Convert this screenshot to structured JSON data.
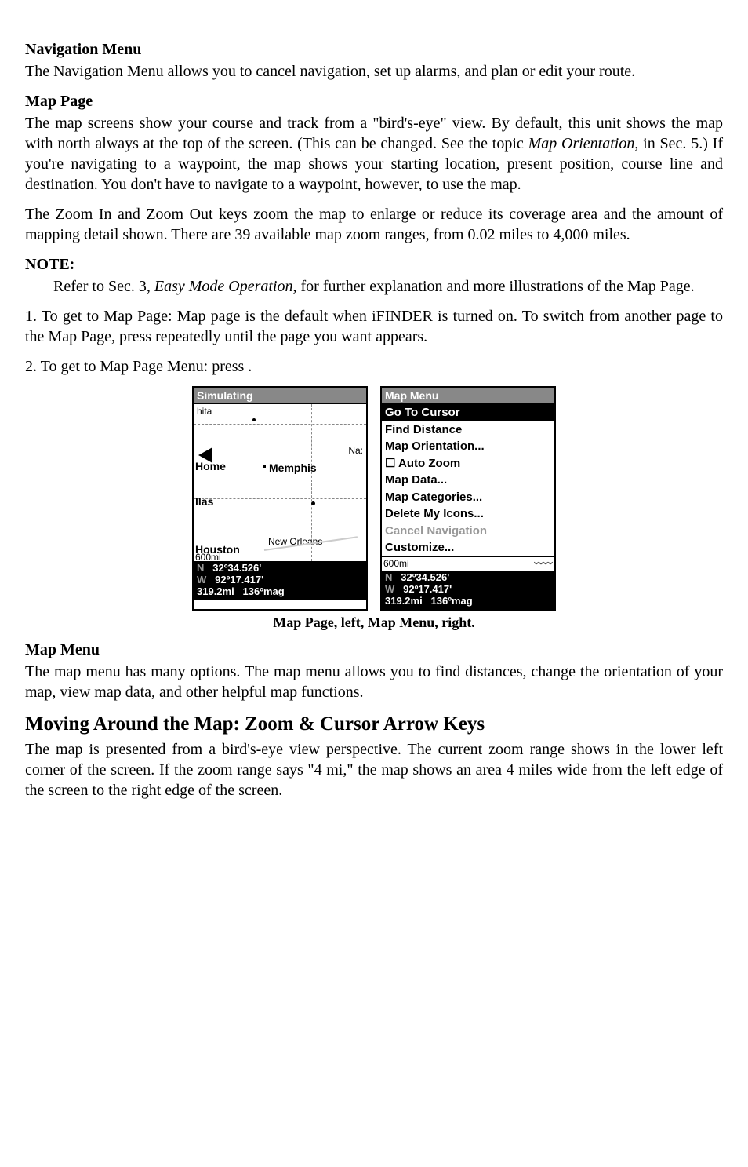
{
  "sec_nav_menu": {
    "heading": "Navigation Menu",
    "body": "The Navigation Menu allows you to cancel navigation, set up alarms, and plan or edit your route."
  },
  "sec_map_page": {
    "heading": "Map Page",
    "p1a": "The map screens show your course and track from a \"bird's-eye\" view. By default, this unit shows the map with north always at the top of the screen. (This can be changed. See the topic ",
    "p1_italic": "Map Orientation",
    "p1b": ", in Sec. 5.) If you're navigating to a waypoint, the map shows your starting location, present position, course line and destination. You don't have to navigate to a waypoint, however, to use the map.",
    "p2": "The Zoom In and Zoom Out keys zoom the map to enlarge or reduce its coverage area and the amount of mapping detail shown. There are 39 available map zoom ranges, from 0.02 miles to 4,000 miles."
  },
  "note": {
    "heading": "NOTE:",
    "body_a": "Refer to Sec. 3, ",
    "body_italic": "Easy Mode Operation",
    "body_b": ", for further explanation and more illustrations of the Map Page."
  },
  "steps": {
    "s1": "1. To get to Map Page: Map page is the default when iFINDER is turned on. To switch from another page to the Map Page, press repeatedly until the page you want appears.",
    "s2": "2. To get to Map Page Menu: press       ."
  },
  "figure": {
    "left": {
      "title": "Simulating",
      "labels": {
        "hita": "hita",
        "na": "Na:",
        "home": "Home",
        "memphis": "Memphis",
        "llas": "llas",
        "houston": "Houston",
        "range": "600mi",
        "neworleans": "New Orleans"
      },
      "coords": {
        "lat_pre": "N",
        "lat": "32º34.526'",
        "lon_pre": "W",
        "lon": "92º17.417'",
        "dist": "319.2mi",
        "brg": "136ºmag"
      }
    },
    "right": {
      "title": "Map Menu",
      "items": [
        {
          "label": "Go To Cursor",
          "selected": true
        },
        {
          "label": "Find Distance"
        },
        {
          "label": "Map Orientation..."
        },
        {
          "label": "☐ Auto Zoom"
        },
        {
          "label": "Map Data..."
        },
        {
          "label": "Map Categories..."
        },
        {
          "label": "Delete My Icons..."
        },
        {
          "label": "Cancel Navigation",
          "disabled": true
        },
        {
          "label": "Customize..."
        }
      ],
      "status_range": "600mi",
      "coords": {
        "lat_pre": "N",
        "lat": "32º34.526'",
        "lon_pre": "W",
        "lon": "92º17.417'",
        "dist": "319.2mi",
        "brg": "136ºmag"
      }
    },
    "caption": "Map Page, left, Map Menu, right."
  },
  "sec_map_menu": {
    "heading": "Map Menu",
    "body": "The map menu has many options. The map menu allows you to find distances, change the orientation of your map, view map data, and other helpful map functions."
  },
  "sec_moving": {
    "heading": "Moving Around the Map: Zoom & Cursor Arrow Keys",
    "body": "The map is presented from a bird's-eye view perspective. The current zoom range shows in the lower left corner of the screen. If the zoom range says \"4 mi,\" the map shows an area 4 miles wide from the left edge of the screen to the right edge of the screen."
  }
}
